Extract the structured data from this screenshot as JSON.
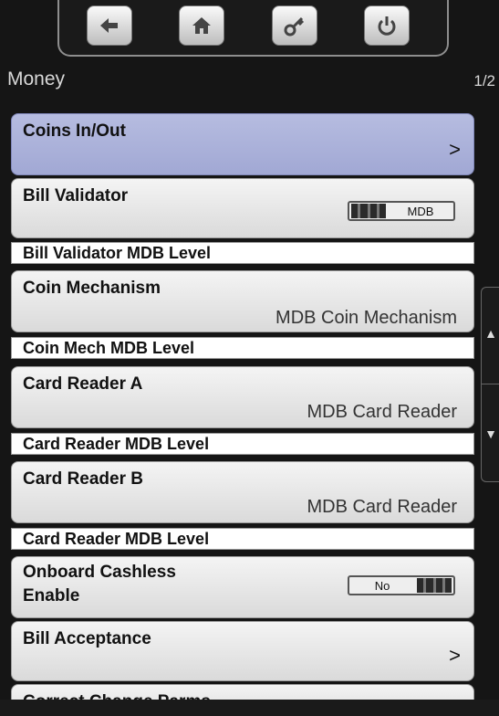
{
  "nav": {
    "buttons": [
      "back-icon",
      "home-icon",
      "key-icon",
      "power-icon"
    ]
  },
  "page": {
    "title": "Money",
    "page_indicator": "1/2"
  },
  "menu": {
    "coins_in_out": {
      "label": "Coins In/Out",
      "chevron": ">"
    },
    "bill_validator": {
      "label": "Bill Validator",
      "toggle_value": "MDB"
    },
    "bill_validator_level": {
      "label": "Bill Validator MDB Level"
    },
    "coin_mechanism": {
      "label": "Coin Mechanism",
      "value": "MDB Coin Mechanism"
    },
    "coin_mech_level": {
      "label": "Coin Mech MDB Level"
    },
    "card_reader_a": {
      "label": "Card Reader A",
      "value": "MDB Card Reader"
    },
    "card_reader_a_level": {
      "label": "Card Reader MDB Level"
    },
    "card_reader_b": {
      "label": "Card Reader B",
      "value": "MDB Card Reader"
    },
    "card_reader_b_level": {
      "label": "Card Reader MDB Level"
    },
    "onboard_cashless": {
      "label_line1": "Onboard Cashless",
      "label_line2": "Enable",
      "toggle_value": "No"
    },
    "bill_acceptance": {
      "label": "Bill Acceptance",
      "chevron": ">"
    },
    "correct_change": {
      "label": "Correct Change Parms"
    }
  },
  "scroll": {
    "up": "▲",
    "down": "▼"
  },
  "colors": {
    "selected_bg": "#a8aed8",
    "item_bg": "#e6e6e6",
    "background": "#151515"
  }
}
